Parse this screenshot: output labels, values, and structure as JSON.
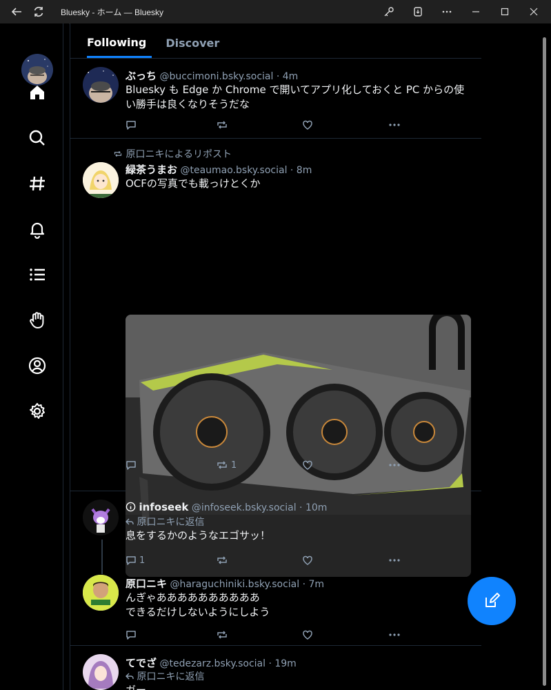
{
  "window": {
    "title": "Bluesky - ホーム — Bluesky"
  },
  "tabs": [
    {
      "label": "Following"
    },
    {
      "label": "Discover"
    }
  ],
  "posts": [
    {
      "name": "ぶっち",
      "handle": "@buccimoni.bsky.social",
      "time": "· 4m",
      "text": "Bluesky も Edge か Chrome で開いてアプリ化しておくと PC からの使い勝手は良くなりそうだな",
      "reply_count": "",
      "repost_count": "",
      "like_count": ""
    },
    {
      "reposted_by": "原口ニキによるリポスト",
      "name": "緑茶うまお",
      "handle": "@teaumao.bsky.social",
      "time": "· 8m",
      "text": "OCFの写真でも載っけとくか",
      "reply_count": "",
      "repost_count": "1",
      "like_count": ""
    },
    {
      "name": "infoseek",
      "handle": "@infoseek.bsky.social",
      "time": "· 10m",
      "reply_to": "原口ニキに返信",
      "text": "息をするかのようなエゴサッ！",
      "reply_count": "1",
      "repost_count": "",
      "like_count": ""
    },
    {
      "name": "原口ニキ",
      "handle": "@haraguchiniki.bsky.social",
      "time": "· 7m",
      "text_line1": "んぎゃああああああああああ",
      "text_line2": "できるだけしないようにしよう",
      "reply_count": "",
      "repost_count": "",
      "like_count": ""
    },
    {
      "name": "てでざ",
      "handle": "@tedezarz.bsky.social",
      "time": "· 19m",
      "reply_to": "原口ニキに返信",
      "text": "ガー"
    }
  ],
  "icons": {
    "nav": [
      "home-icon",
      "search-icon",
      "hashtag-icon",
      "notifications-icon",
      "lists-icon",
      "moderation-icon",
      "profile-icon",
      "settings-icon"
    ],
    "accent": "#1083fe"
  }
}
